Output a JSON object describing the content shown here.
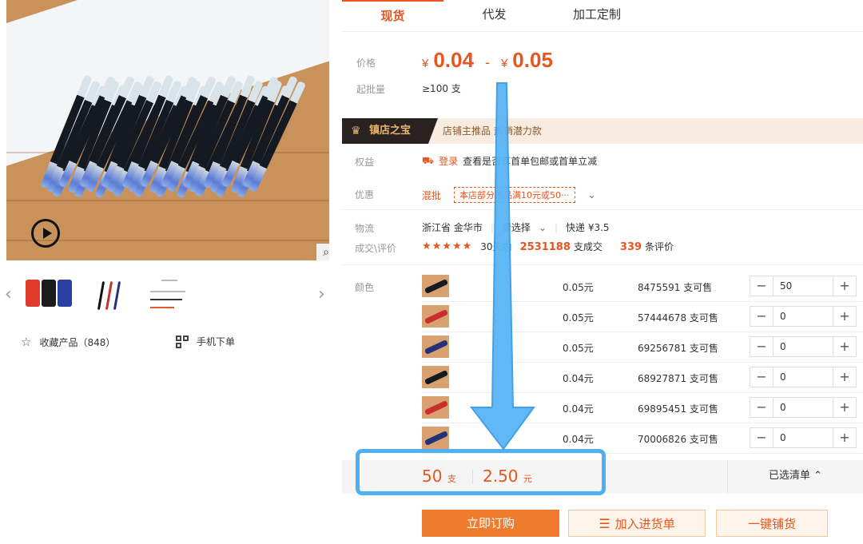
{
  "tabs": [
    "现货",
    "代发",
    "加工定制"
  ],
  "price": {
    "label": "价格",
    "currency": "¥",
    "min": "0.04",
    "dash": "-",
    "max": "0.05",
    "moq_label": "起批量",
    "moq_value": "≥100 支"
  },
  "banner": {
    "badge": "镇店之宝",
    "subtitle": "店铺主推品 热销潜力款"
  },
  "benefit": {
    "label": "权益",
    "login": "登录",
    "text": "查看是否享首单包邮或首单立减"
  },
  "discount": {
    "label": "优惠",
    "tag": "混批",
    "coupon": "本店部分商品满10元或50···"
  },
  "logistics": {
    "label": "物流",
    "origin": "浙江省 金华市",
    "dest": "请选择",
    "shipping": "快递 ¥3.5"
  },
  "rating": {
    "label": "成交\\评价",
    "stars": "★★★★★",
    "period": "30天内",
    "deals": "2531188",
    "deals_suffix": "支成交",
    "reviews": "339",
    "reviews_suffix": "条评价"
  },
  "variants_label": "颜色",
  "variants": [
    {
      "price": "0.05元",
      "stock": "8475591 支可售",
      "qty": "50",
      "color": "#151a22"
    },
    {
      "price": "0.05元",
      "stock": "57444678 支可售",
      "qty": "0",
      "color": "#c9302c"
    },
    {
      "price": "0.05元",
      "stock": "69256781 支可售",
      "qty": "0",
      "color": "#25327a"
    },
    {
      "price": "0.04元",
      "stock": "68927871 支可售",
      "qty": "0",
      "color": "#151a22"
    },
    {
      "price": "0.04元",
      "stock": "69895451 支可售",
      "qty": "0",
      "color": "#c9302c"
    },
    {
      "price": "0.04元",
      "stock": "70006826 支可售",
      "qty": "0",
      "color": "#25327a"
    }
  ],
  "stepper": {
    "minus": "−",
    "plus": "+"
  },
  "summary": {
    "qty": "50",
    "qty_unit": "支",
    "total": "2.50",
    "total_unit": "元",
    "selected": "已选清单 ⌃"
  },
  "buttons": {
    "buy": "立即订购",
    "cart": "加入进货单",
    "distribute": "一键铺货"
  },
  "gallery": {
    "favorite": "收藏产品（848）",
    "mobile": "手机下单",
    "prev": "‹",
    "next": "›",
    "zoom": "⌕"
  },
  "annotation_color": "#4fb0f4"
}
